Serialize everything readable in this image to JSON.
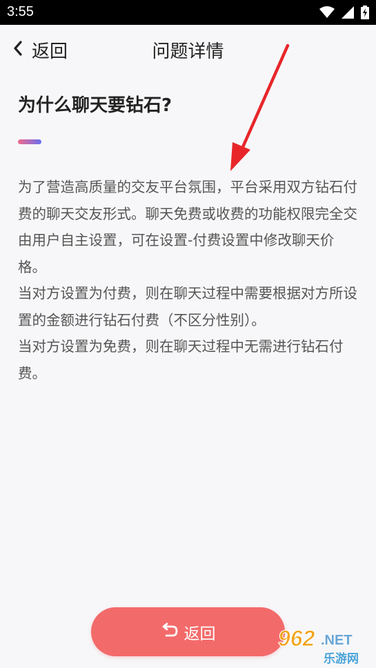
{
  "status_bar": {
    "time": "3:55",
    "icons": [
      "wifi-icon",
      "signal-icon",
      "battery-charging-icon"
    ]
  },
  "header": {
    "back_label": "返回",
    "title": "问题详情"
  },
  "content": {
    "question": "为什么聊天要钻石?",
    "answer": "为了营造高质量的交友平台氛围，平台采用双方钻石付费的聊天交友形式。聊天免费或收费的功能权限完全交由用户自主设置，可在设置-付费设置中修改聊天价格。\n当对方设置为付费，则在聊天过程中需要根据对方所设置的金额进行钻石付费（不区分性别）。\n当对方设置为免费，则在聊天过程中无需进行钻石付费。"
  },
  "bottom_button": {
    "label": "返回",
    "icon": "undo-icon"
  },
  "colors": {
    "accent_button": "#f36a6a",
    "accent_bar_start": "#f26a8a",
    "accent_bar_end": "#6a6ff0",
    "annotation_arrow": "#e8262a"
  }
}
